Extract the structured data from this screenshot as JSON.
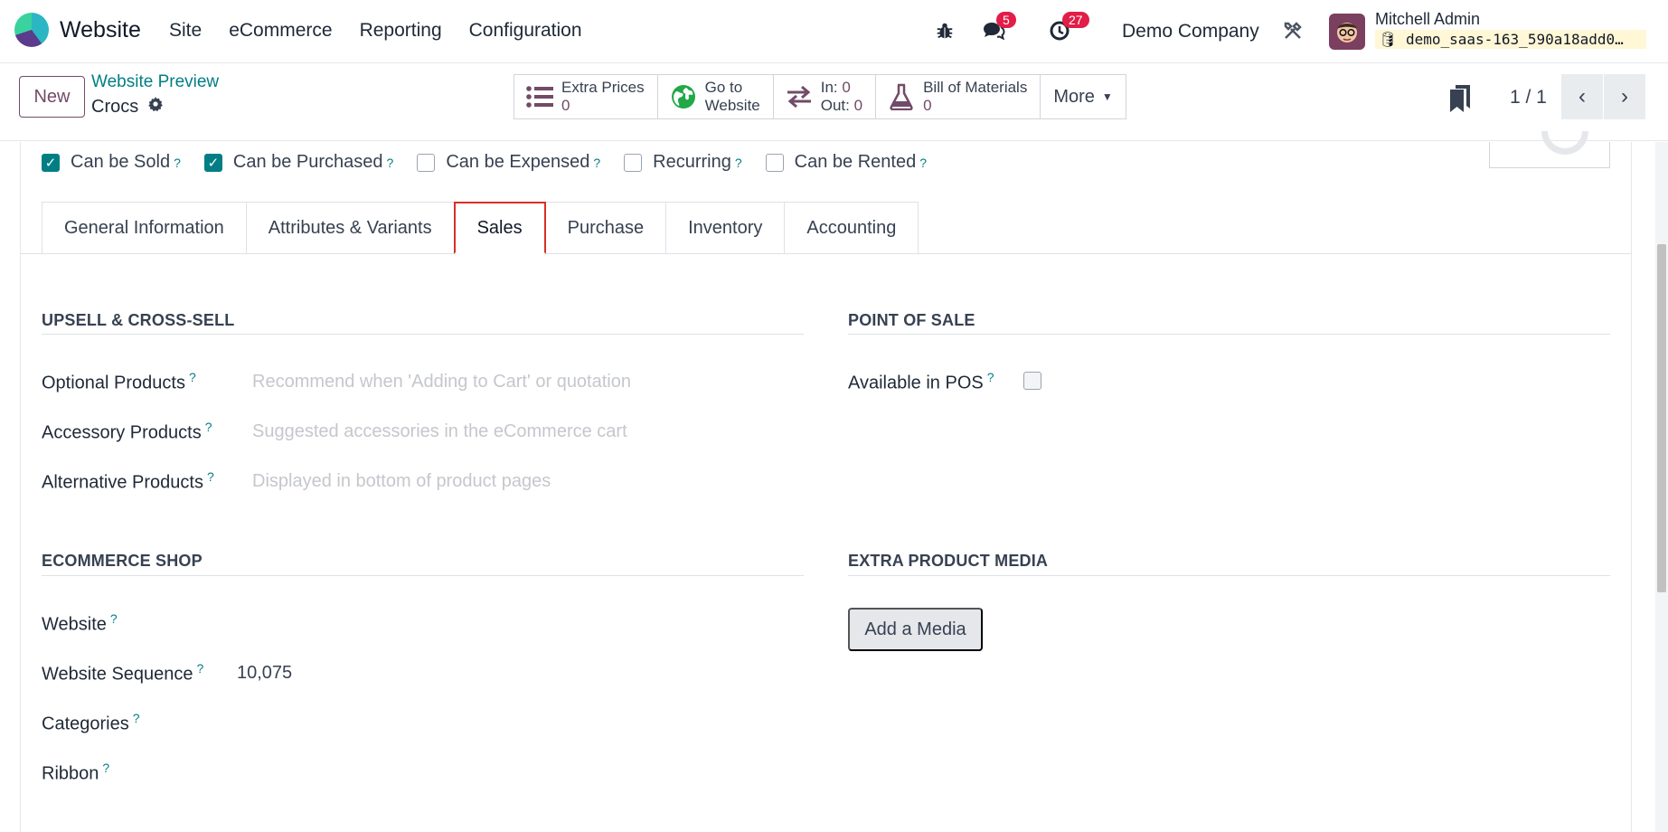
{
  "app": {
    "name": "Website"
  },
  "menu": [
    "Site",
    "eCommerce",
    "Reporting",
    "Configuration"
  ],
  "systray": {
    "messages_count": "5",
    "activities_count": "27",
    "company": "Demo Company",
    "user_name": "Mitchell Admin",
    "database": "demo_saas-163_590a18add0…"
  },
  "control": {
    "new_label": "New",
    "breadcrumb_parent": "Website Preview",
    "record_name": "Crocs",
    "smart_buttons": {
      "extra_prices_label": "Extra Prices",
      "extra_prices_value": "0",
      "go_to_line1": "Go to",
      "go_to_line2": "Website",
      "in_label": "In:",
      "in_value": "0",
      "out_label": "Out:",
      "out_value": "0",
      "bom_label": "Bill of Materials",
      "bom_value": "0",
      "more_label": "More"
    },
    "pager": "1 / 1"
  },
  "checkboxes": [
    {
      "label": "Can be Sold",
      "checked": true
    },
    {
      "label": "Can be Purchased",
      "checked": true
    },
    {
      "label": "Can be Expensed",
      "checked": false
    },
    {
      "label": "Recurring",
      "checked": false
    },
    {
      "label": "Can be Rented",
      "checked": false
    }
  ],
  "tabs": [
    "General Information",
    "Attributes & Variants",
    "Sales",
    "Purchase",
    "Inventory",
    "Accounting"
  ],
  "upsell": {
    "title": "UPSELL & CROSS-SELL",
    "optional_label": "Optional Products",
    "optional_placeholder": "Recommend when 'Adding to Cart' or quotation",
    "accessory_label": "Accessory Products",
    "accessory_placeholder": "Suggested accessories in the eCommerce cart",
    "alternative_label": "Alternative Products",
    "alternative_placeholder": "Displayed in bottom of product pages"
  },
  "pos": {
    "title": "POINT OF SALE",
    "available_label": "Available in POS"
  },
  "ecommerce": {
    "title": "ECOMMERCE SHOP",
    "website_label": "Website",
    "sequence_label": "Website Sequence",
    "sequence_value": "10,075",
    "categories_label": "Categories",
    "ribbon_label": "Ribbon"
  },
  "media": {
    "title": "EXTRA PRODUCT MEDIA",
    "add_label": "Add a Media"
  },
  "help_mark": "?",
  "colors": {
    "brand": "#714b67",
    "accent": "#017e84",
    "badge": "#e11d48",
    "active_tab_border": "#d93025"
  }
}
